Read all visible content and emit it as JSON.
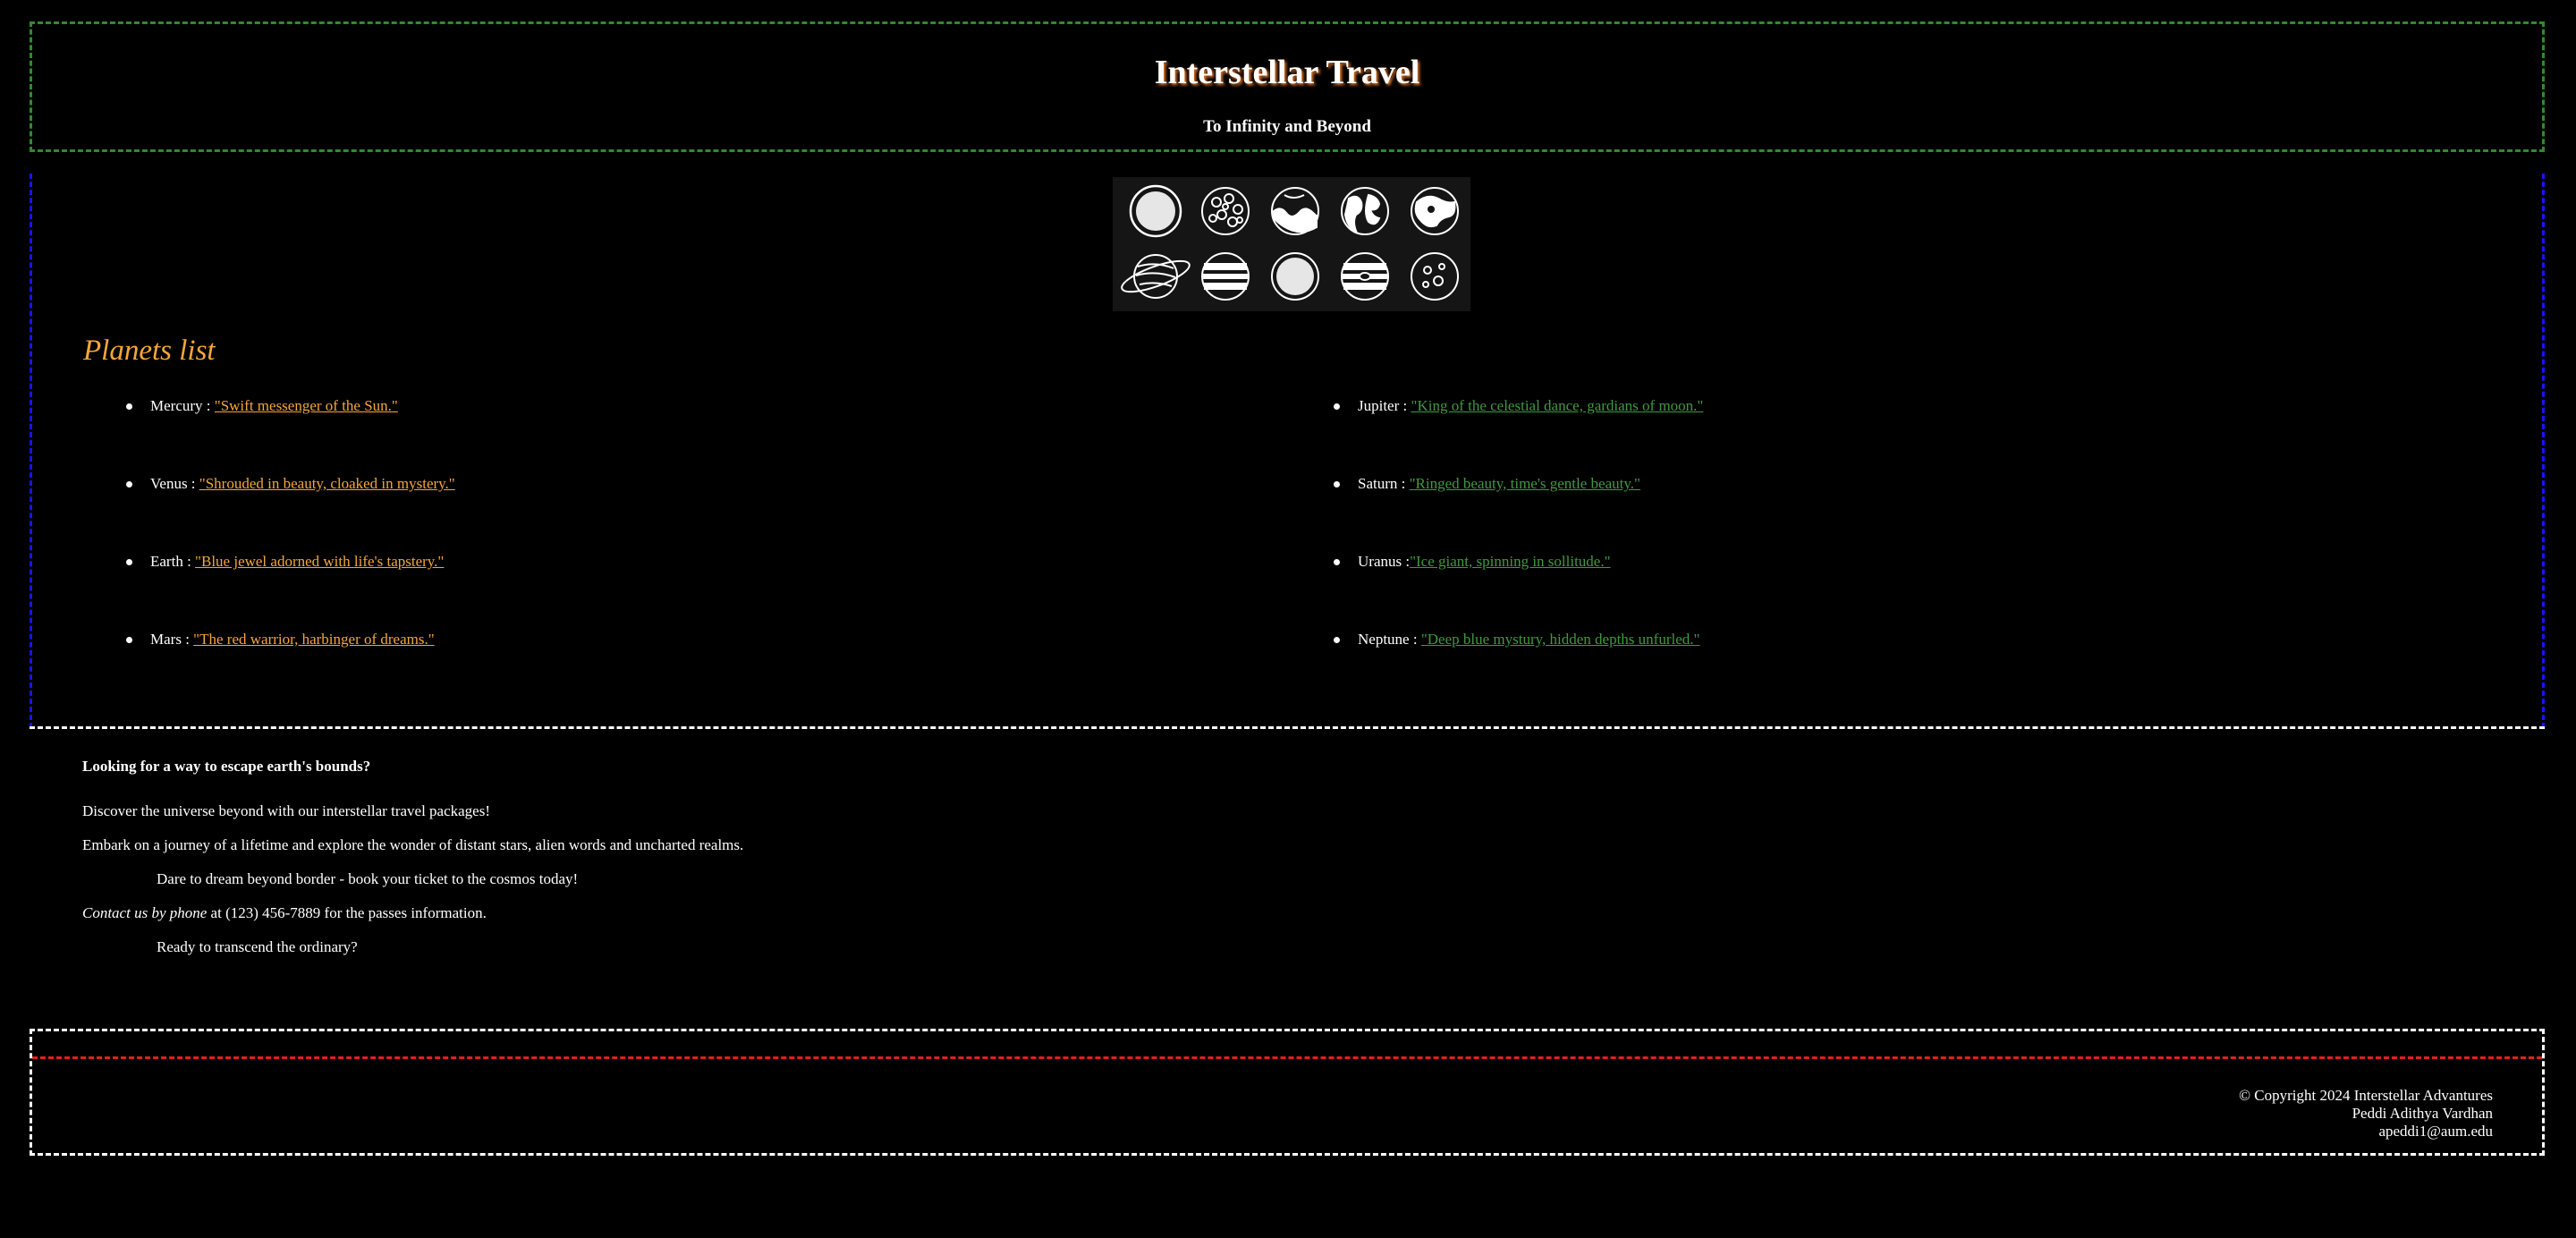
{
  "header": {
    "title": "Interstellar Travel",
    "subtitle": "To Infinity and Beyond"
  },
  "planets_image": {
    "icons": [
      "sun-icon",
      "mercury-icon",
      "venus-icon",
      "earth-icon",
      "moon-icon",
      "saturn-icon",
      "jupiter-icon",
      "uranus-icon",
      "neptune-icon",
      "pluto-icon"
    ]
  },
  "planets": {
    "heading": "Planets list",
    "inner": [
      {
        "name": "Mercury : ",
        "quote": "\"Swift messenger of the Sun.\""
      },
      {
        "name": "Venus : ",
        "quote": "\"Shrouded in beauty, cloaked in mystery.\""
      },
      {
        "name": "Earth : ",
        "quote": "\"Blue jewel adorned with life's tapstery.\""
      },
      {
        "name": "Mars : ",
        "quote": "\"The red warrior, harbinger of dreams.\""
      }
    ],
    "outer": [
      {
        "name": "Jupiter : ",
        "quote": "\"King of the celestial dance, gardians of moon.\""
      },
      {
        "name": "Saturn : ",
        "quote": "\"Ringed beauty, time's gentle beauty.\""
      },
      {
        "name": "Uranus :",
        "quote": "\"Ice giant, spinning in sollitude.\""
      },
      {
        "name": "Neptune : ",
        "quote": "\"Deep blue mystury, hidden depths unfurled.\""
      }
    ]
  },
  "info": {
    "question": "Looking for a way to escape earth's bounds?",
    "line1": "Discover the universe beyond with our interstellar travel packages!",
    "line2": "Embark on a journey of a lifetime and explore the wonder of distant stars, alien words and uncharted realms.",
    "line3": "Dare to dream beyond border - book your ticket to the cosmos today!",
    "contact_em": "Contact us by phone",
    "contact_rest": " at (123) 456-7889 for the passes information.",
    "line5": "Ready to transcend the ordinary?"
  },
  "footer": {
    "copyright": "© Copyright 2024 Interstellar Advantures",
    "author": "Peddi Adithya Vardhan",
    "email": "apeddi1@aum.edu"
  },
  "colors": {
    "header_border": "#2e8b2e",
    "main_border": "#1414ff",
    "footer_red_line": "#e02020",
    "accent_orange": "#f5a63a",
    "link_green": "#3f9a3f"
  }
}
